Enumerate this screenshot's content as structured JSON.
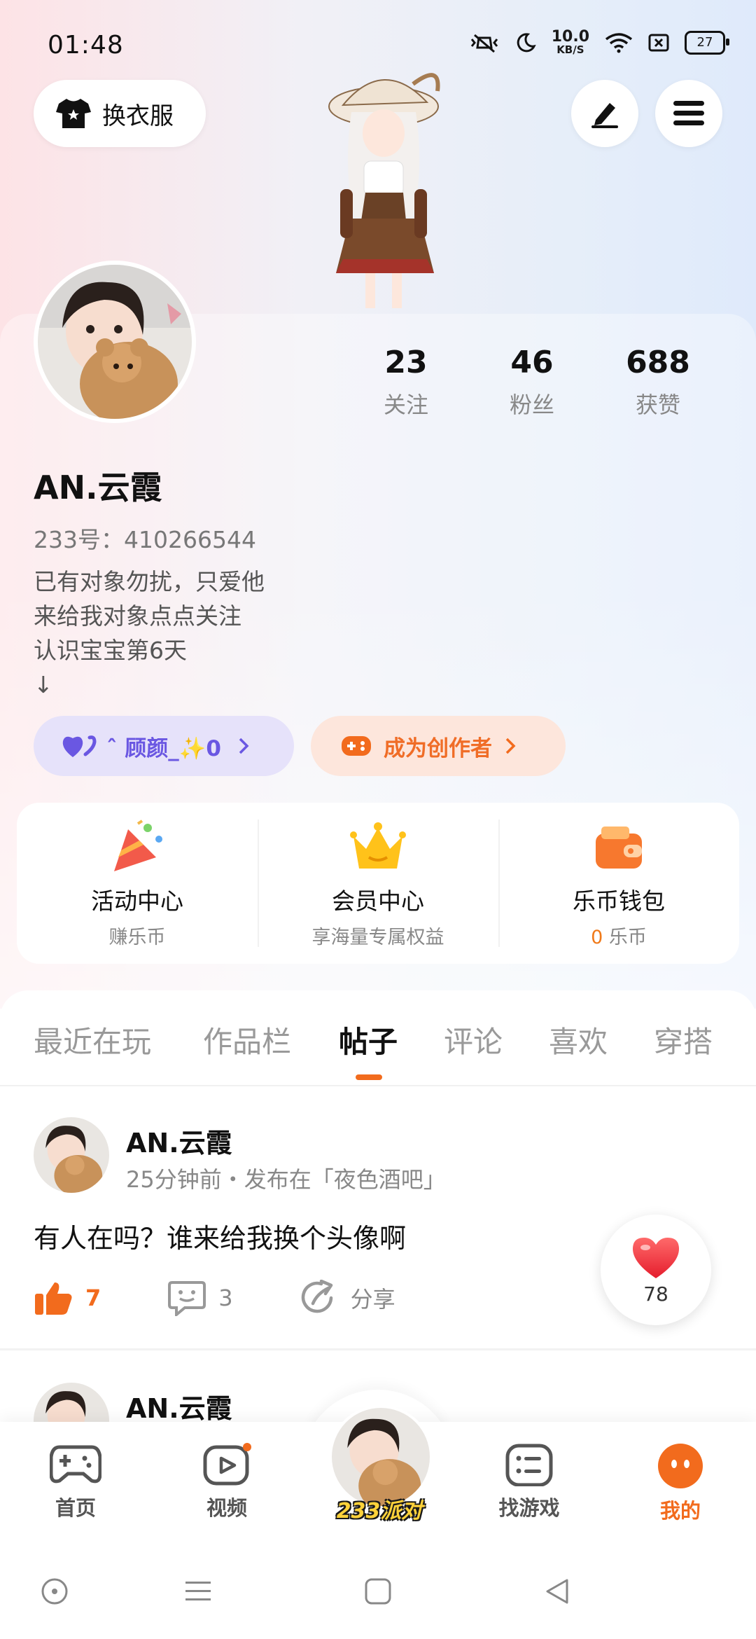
{
  "status": {
    "time": "01:48",
    "net_value": "10.0",
    "net_unit": "KB/S",
    "battery": "27"
  },
  "top": {
    "outfit_label": "换衣服"
  },
  "profile": {
    "stats": [
      {
        "num": "23",
        "label": "关注"
      },
      {
        "num": "46",
        "label": "粉丝"
      },
      {
        "num": "688",
        "label": "获赞"
      }
    ],
    "name": "AN.云霞",
    "id_text": "233号：410266544",
    "bio": [
      "已有对象勿扰，只爱他",
      "来给我对象点点关注",
      "认识宝宝第6天",
      "↓"
    ],
    "pill_partner": "ˆ 顾颜_✨0",
    "pill_creator": "成为创作者"
  },
  "quick": [
    {
      "title": "活动中心",
      "sub": "赚乐币",
      "sub_num": "",
      "sub_unit": ""
    },
    {
      "title": "会员中心",
      "sub": "享海量专属权益",
      "sub_num": "",
      "sub_unit": ""
    },
    {
      "title": "乐币钱包",
      "sub": "",
      "sub_num": "0",
      "sub_unit": " 乐币"
    }
  ],
  "tabs": [
    "最近在玩",
    "作品栏",
    "帖子",
    "评论",
    "喜欢",
    "穿搭"
  ],
  "active_tab": "帖子",
  "posts": [
    {
      "author": "AN.云霞",
      "meta": "25分钟前・发布在「夜色酒吧」",
      "text": "有人在吗？谁来给我换个头像啊",
      "likes": "7",
      "comments": "3",
      "share": "分享"
    },
    {
      "author": "AN.云霞"
    }
  ],
  "heart_count": "78",
  "nav": {
    "home": "首页",
    "video": "视频",
    "center": "233派对",
    "games": "找游戏",
    "mine": "我的"
  },
  "colors": {
    "accent": "#f26b1d",
    "purple": "#6a57e2"
  }
}
